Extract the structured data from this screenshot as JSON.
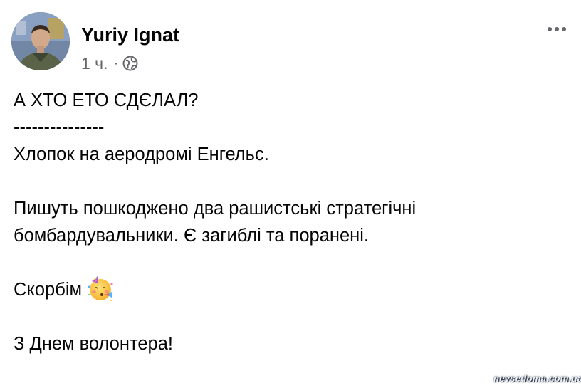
{
  "post": {
    "author_name": "Yuriy Ignat",
    "time": "1 ч.",
    "separator": "·",
    "privacy_icon": "globe-icon",
    "more_icon": "more-horizontal-icon",
    "lines": {
      "l1": "А ХТО ЕТО СДЄЛАЛ?",
      "l2": "---------------",
      "l3": "Хлопок на аеродромі Енгельс.",
      "l4": "Пишуть пошкоджено два рашистські стратегічні",
      "l5": "бомбардувальники. Є загиблі та поранені.",
      "l6": "Скорбім",
      "l7": "З Днем волонтера!"
    },
    "emoji_icon": "partying-face-emoji"
  },
  "watermark": "nevsedoma.com.ua",
  "colors": {
    "text": "#050505",
    "secondary_text": "#65676b",
    "background": "#ffffff"
  }
}
